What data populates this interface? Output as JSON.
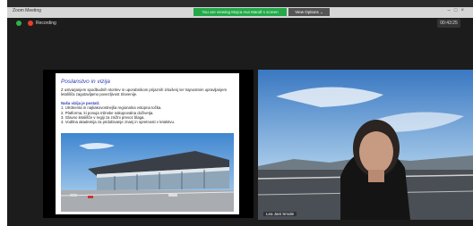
{
  "window": {
    "title": "Zoom Meeting"
  },
  "banner": {
    "text": "You are viewing Mojca Ava Mandl s screen"
  },
  "view_options": {
    "label": "View Options ⌄"
  },
  "recording": {
    "label": "Recording"
  },
  "timer": {
    "value": "00:43:25"
  },
  "slide": {
    "title": "Poslanstvo in vizija",
    "paragraph": "Z ustvarjanjem spodbudnih storitev in uporabnikom prijaznih izkušenj ter trajnostnim upravljanjem letališča zagotavljamo povezljivost Slovenije.",
    "subheading": "Naša vizija je postati:",
    "items": [
      "1. Utrdnenta in najkakovostnejša regionalna vstopna točka.",
      "2. Platforma, ki ponuja mlinske nakupovalna doživetja.",
      "3. Glavno letališče v regiji za znižni prevoz blaga.",
      "4. Vodilna akademija za pridobivanje znanj in spretnosti v letalstvu."
    ]
  },
  "participant": {
    "name": "Lea Jani Smole"
  },
  "colors": {
    "banner": "#23a84a",
    "slide_title": "#2b3fb3",
    "rec_dot": "#e6402b",
    "status_dot": "#2fb34a"
  }
}
